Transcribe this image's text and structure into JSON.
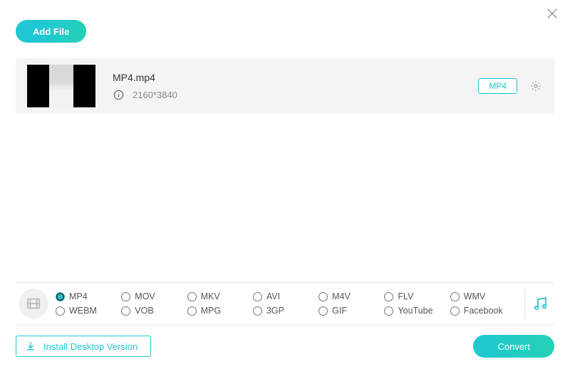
{
  "header": {
    "add_file_label": "Add File"
  },
  "file": {
    "name": "MP4.mp4",
    "resolution": "2160*3840",
    "format_tag": "MP4"
  },
  "formats": {
    "selected_index": 0,
    "row1": [
      "MP4",
      "MOV",
      "MKV",
      "AVI",
      "M4V",
      "FLV",
      "WMV"
    ],
    "row2": [
      "WEBM",
      "VOB",
      "MPG",
      "3GP",
      "GIF",
      "YouTube",
      "Facebook"
    ]
  },
  "footer": {
    "install_label": "Install Desktop Version",
    "convert_label": "Convert"
  }
}
